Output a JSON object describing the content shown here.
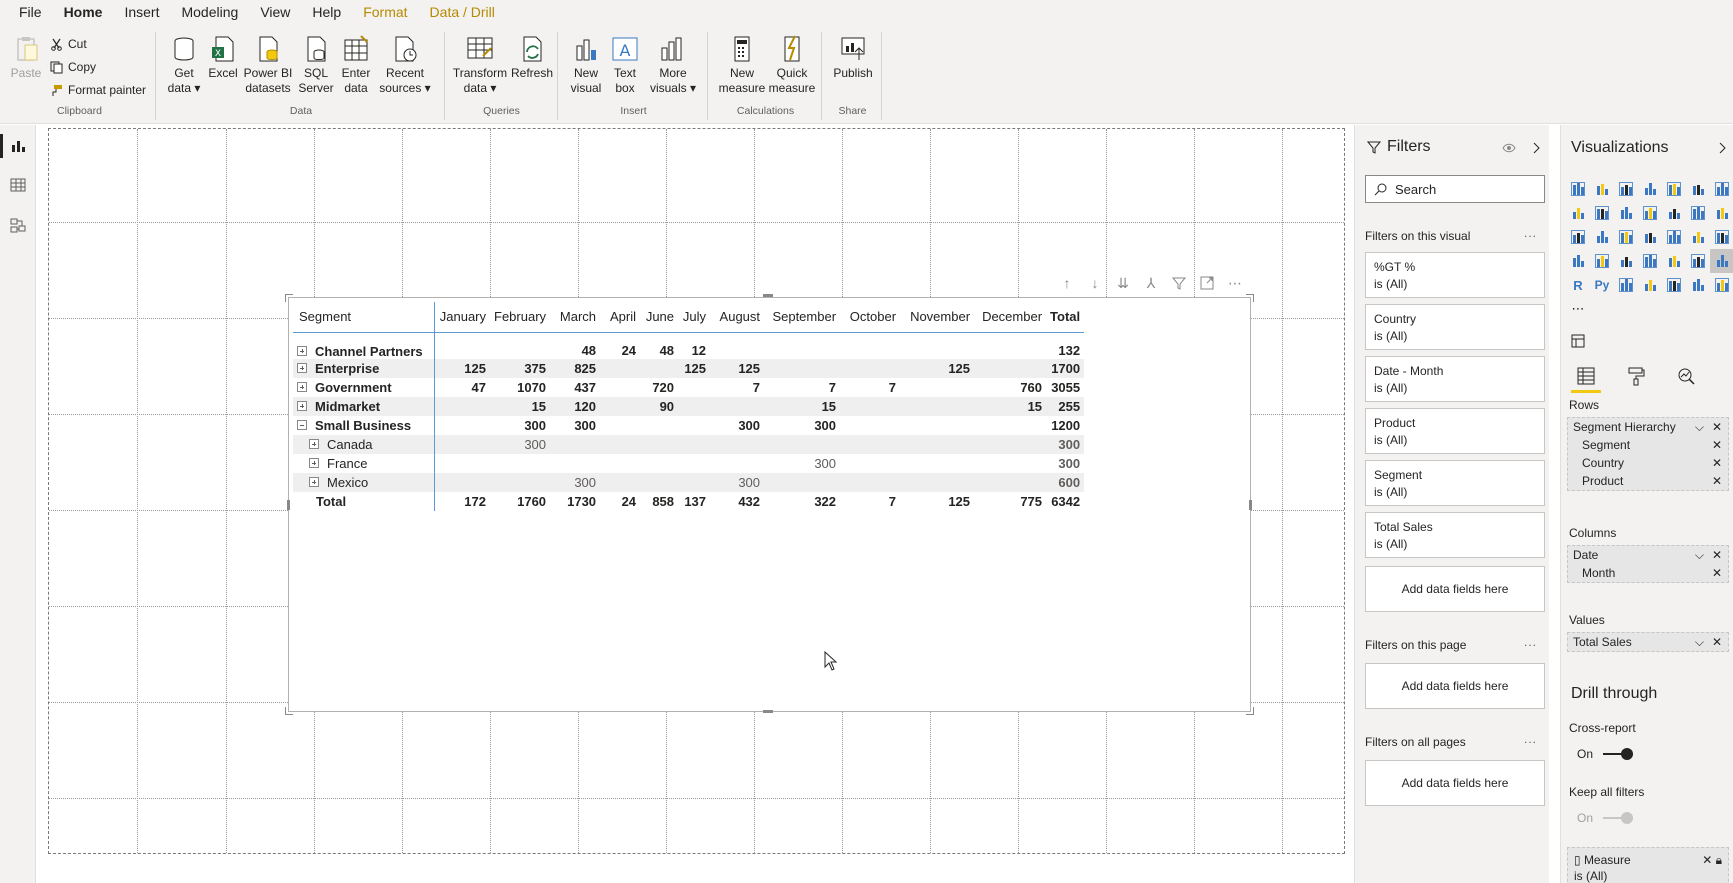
{
  "menu": {
    "items": [
      "File",
      "Home",
      "Insert",
      "Modeling",
      "View",
      "Help",
      "Format",
      "Data / Drill"
    ],
    "active": "Home"
  },
  "ribbon": {
    "clipboard": {
      "paste": "Paste",
      "cut": "Cut",
      "copy": "Copy",
      "format_painter": "Format painter",
      "label": "Clipboard"
    },
    "data": {
      "get_data_1": "Get",
      "get_data_2": "data",
      "excel": "Excel",
      "pbi_1": "Power BI",
      "pbi_2": "datasets",
      "sql_1": "SQL",
      "sql_2": "Server",
      "enter_1": "Enter",
      "enter_2": "data",
      "recent_1": "Recent",
      "recent_2": "sources",
      "label": "Data"
    },
    "queries": {
      "transform_1": "Transform",
      "transform_2": "data",
      "refresh": "Refresh",
      "label": "Queries"
    },
    "insert": {
      "new_visual_1": "New",
      "new_visual_2": "visual",
      "text_box_1": "Text",
      "text_box_2": "box",
      "more_1": "More",
      "more_2": "visuals",
      "label": "Insert"
    },
    "calculations": {
      "new_measure_1": "New",
      "new_measure_2": "measure",
      "quick_measure_1": "Quick",
      "quick_measure_2": "measure",
      "label": "Calculations"
    },
    "share": {
      "publish": "Publish",
      "label": "Share"
    }
  },
  "matrix": {
    "row_header": "Segment",
    "columns": [
      "January",
      "February",
      "March",
      "April",
      "June",
      "July",
      "August",
      "September",
      "October",
      "November",
      "December",
      "Total"
    ],
    "rows": [
      {
        "label": "Channel Partners",
        "level": 0,
        "expanded": false,
        "values": [
          "",
          "",
          "48",
          "24",
          "48",
          "12",
          "",
          "",
          "",
          "",
          "",
          "132"
        ]
      },
      {
        "label": "Enterprise",
        "level": 0,
        "expanded": false,
        "values": [
          "125",
          "375",
          "825",
          "",
          "",
          "125",
          "125",
          "",
          "",
          "125",
          "",
          "1700"
        ]
      },
      {
        "label": "Government",
        "level": 0,
        "expanded": false,
        "values": [
          "47",
          "1070",
          "437",
          "",
          "720",
          "",
          "7",
          "7",
          "7",
          "",
          "760",
          "3055"
        ]
      },
      {
        "label": "Midmarket",
        "level": 0,
        "expanded": false,
        "values": [
          "",
          "15",
          "120",
          "",
          "90",
          "",
          "",
          "15",
          "",
          "",
          "15",
          "255"
        ]
      },
      {
        "label": "Small Business",
        "level": 0,
        "expanded": true,
        "values": [
          "",
          "300",
          "300",
          "",
          "",
          "",
          "300",
          "300",
          "",
          "",
          "",
          "1200"
        ]
      },
      {
        "label": "Canada",
        "level": 1,
        "expanded": false,
        "values": [
          "",
          "300",
          "",
          "",
          "",
          "",
          "",
          "",
          "",
          "",
          "",
          "300"
        ]
      },
      {
        "label": "France",
        "level": 1,
        "expanded": false,
        "values": [
          "",
          "",
          "",
          "",
          "",
          "",
          "",
          "300",
          "",
          "",
          "",
          "300"
        ]
      },
      {
        "label": "Mexico",
        "level": 1,
        "expanded": false,
        "values": [
          "",
          "",
          "300",
          "",
          "",
          "",
          "300",
          "",
          "",
          "",
          "",
          "600"
        ]
      }
    ],
    "total_row": {
      "label": "Total",
      "values": [
        "172",
        "1760",
        "1730",
        "24",
        "858",
        "137",
        "432",
        "322",
        "7",
        "125",
        "775",
        "6342"
      ]
    }
  },
  "filters": {
    "title": "Filters",
    "search_placeholder": "Search",
    "on_visual_label": "Filters on this visual",
    "cards": [
      {
        "name": "%GT %",
        "value": "is (All)"
      },
      {
        "name": "Country",
        "value": "is (All)"
      },
      {
        "name": "Date - Month",
        "value": "is (All)"
      },
      {
        "name": "Product",
        "value": "is (All)"
      },
      {
        "name": "Segment",
        "value": "is (All)"
      },
      {
        "name": "Total Sales",
        "value": "is (All)"
      }
    ],
    "add_fields": "Add data fields here",
    "on_page_label": "Filters on this page",
    "on_all_pages_label": "Filters on all pages",
    "more": "..."
  },
  "visualizations": {
    "title": "Visualizations",
    "rows_label": "Rows",
    "rows_fields": [
      "Segment Hierarchy",
      "Segment",
      "Country",
      "Product"
    ],
    "columns_label": "Columns",
    "columns_fields": [
      "Date",
      "Month"
    ],
    "values_label": "Values",
    "values_fields": [
      "Total Sales"
    ],
    "drill_title": "Drill through",
    "cross_report": "Cross-report",
    "cross_report_state": "On",
    "keep_filters": "Keep all filters",
    "keep_filters_state": "On",
    "measure_name": "Measure",
    "measure_value": "is (All)",
    "icon_r": "R",
    "icon_py": "Py"
  },
  "colors": {
    "accent": "#f2c811",
    "format_tab": "#b58b00",
    "grid_line": "#5b9bd5"
  }
}
